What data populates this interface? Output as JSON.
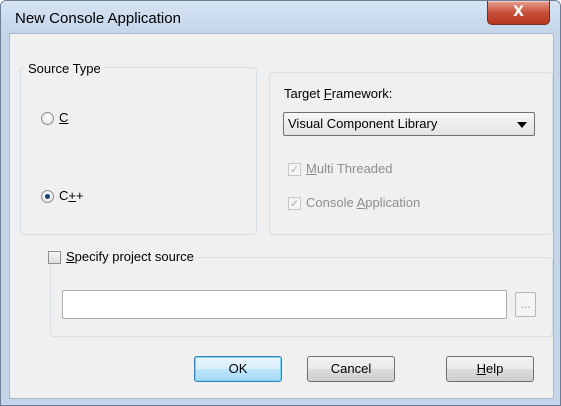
{
  "window": {
    "title": "New Console Application",
    "close_glyph": "X"
  },
  "source_type": {
    "legend": "Source Type",
    "options": [
      {
        "pre": "",
        "accel": "C",
        "post": "",
        "checked": false
      },
      {
        "pre": "C",
        "accel": "+",
        "post": "+",
        "checked": true
      }
    ]
  },
  "target": {
    "label_pre": "Target ",
    "label_accel": "F",
    "label_post": "ramework:",
    "selected": "Visual Component Library",
    "multi_threaded": {
      "accel": "M",
      "post": "ulti Threaded",
      "checked": true,
      "enabled": false
    },
    "console_app": {
      "pre": "Console ",
      "accel": "A",
      "post": "pplication",
      "checked": true,
      "enabled": false
    }
  },
  "project_source": {
    "accel": "S",
    "label_post": "pecify project source",
    "checked": false,
    "value": "",
    "browse_label": "..."
  },
  "buttons": {
    "ok": "OK",
    "cancel": "Cancel",
    "help_accel": "H",
    "help_post": "elp"
  },
  "icons": {
    "close": "close-icon",
    "dropdown": "chevron-down-icon",
    "check": "checkmark-icon"
  },
  "colors": {
    "frame": "#c5d6ea",
    "client": "#f0f0f0",
    "close_button": "#c7503a",
    "default_button": "#3c7fb1"
  }
}
